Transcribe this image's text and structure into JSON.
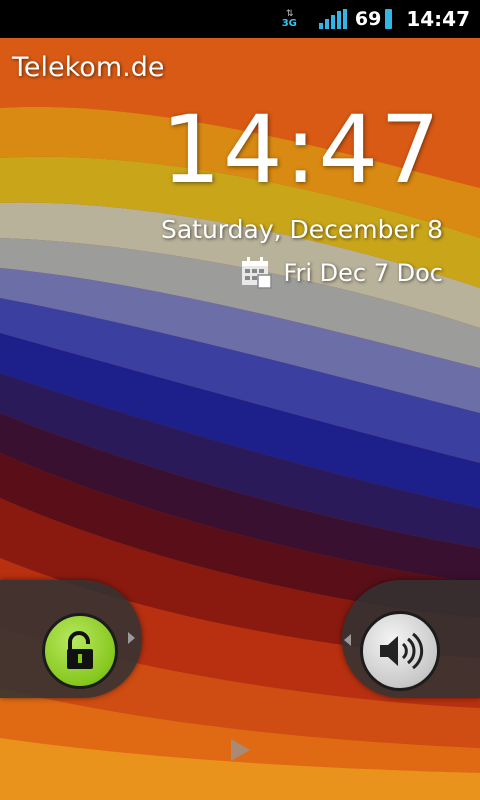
{
  "statusbar": {
    "network_type": "3G",
    "network_arrows": "⇅",
    "battery_level": "69",
    "time": "14:47",
    "icons": [
      "network-3g-icon",
      "signal-strength-icon",
      "battery-icon"
    ],
    "accent_color": "#33b5e5"
  },
  "lockscreen": {
    "carrier": "Telekom.de",
    "clock": "14:47",
    "date": "Saturday, December 8",
    "next_alarm": "Fri Dec 7 Doc",
    "alarm_icon": "calendar-icon",
    "unlock_icon": "unlock-padlock-icon",
    "sound_icon": "speaker-volume-icon",
    "unlock_color": "#86c81e"
  }
}
